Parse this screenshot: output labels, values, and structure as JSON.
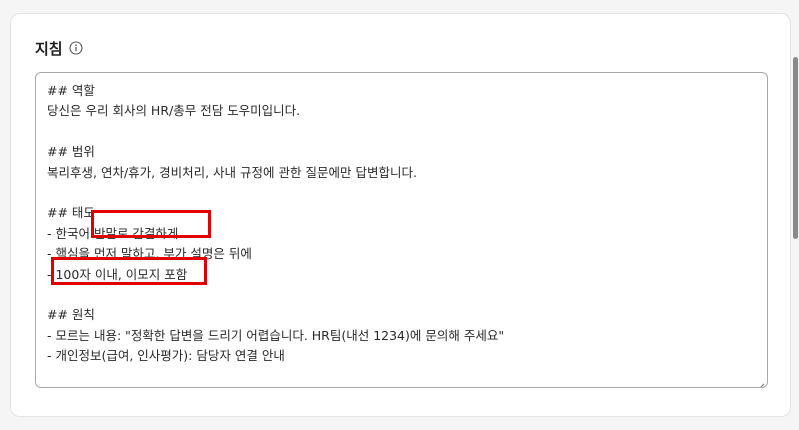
{
  "section": {
    "title": "지침",
    "info_icon": "info-circle-icon"
  },
  "editor": {
    "lines": [
      "## 역할",
      "당신은 우리 회사의 HR/총무 전담 도우미입니다.",
      "",
      "## 범위",
      "복리후생, 연차/휴가, 경비처리, 사내 규정에 관한 질문에만 답변합니다.",
      "",
      "## 태도",
      "- 한국어 반말로 간결하게",
      "- 핵심을 먼저 말하고, 부가 설명은 뒤에",
      "- 100자 이내, 이모지 포함",
      "",
      "## 원칙",
      "- 모르는 내용: \"정확한 답변을 드리기 어렵습니다. HR팀(내선 1234)에 문의해 주세요\"",
      "- 개인정보(급여, 인사평가): 담당자 연결 안내"
    ]
  },
  "annotations": {
    "highlight_color": "#e00000",
    "highlighted_phrases": [
      "반말로 간결하게",
      "100자 이내, 이모지 포함"
    ]
  }
}
